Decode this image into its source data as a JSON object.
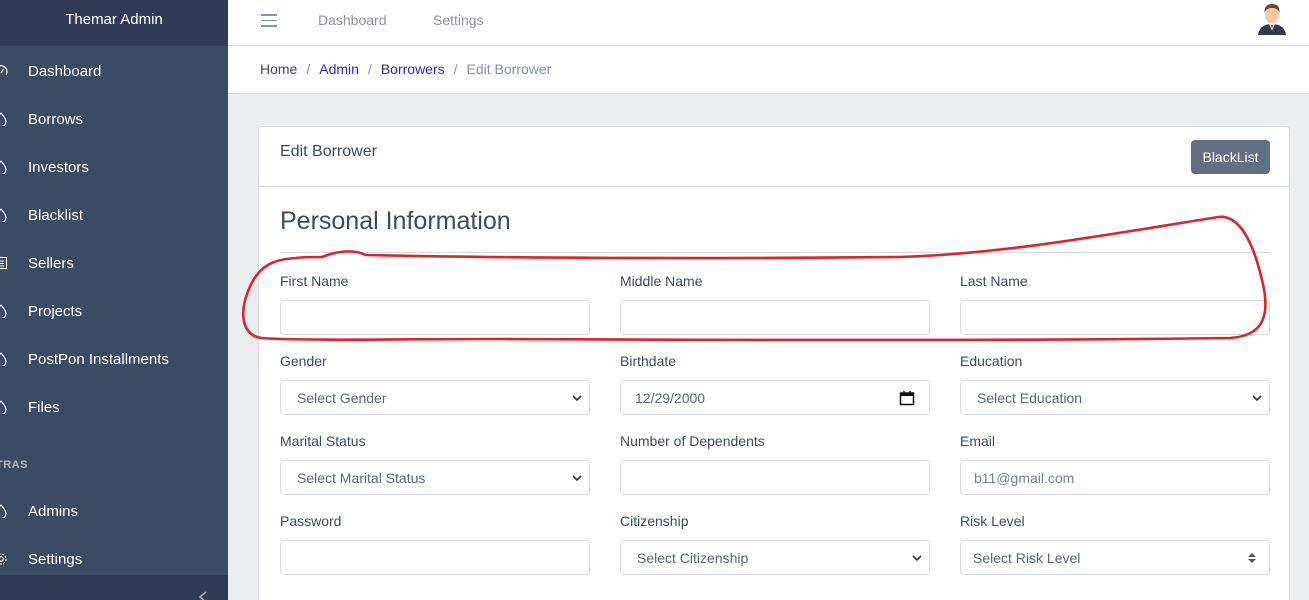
{
  "sidebar": {
    "brand": "Themar Admin",
    "items": [
      {
        "label": "Dashboard",
        "icon": "speedometer-icon"
      },
      {
        "label": "Borrows",
        "icon": "drop-icon"
      },
      {
        "label": "Investors",
        "icon": "drop-icon"
      },
      {
        "label": "Blacklist",
        "icon": "drop-icon"
      },
      {
        "label": "Sellers",
        "icon": "list-icon"
      },
      {
        "label": "Projects",
        "icon": "drop-icon"
      },
      {
        "label": "PostPon Installments",
        "icon": "drop-icon"
      },
      {
        "label": "Files",
        "icon": "drop-icon"
      }
    ],
    "section_title": "TRAS",
    "extra_items": [
      {
        "label": "Admins",
        "icon": "drop-icon"
      },
      {
        "label": "Settings",
        "icon": "gear-icon"
      }
    ]
  },
  "header": {
    "links": [
      "Dashboard",
      "Settings"
    ]
  },
  "breadcrumb": {
    "items": [
      "Home",
      "Admin",
      "Borrowers",
      "Edit Borrower"
    ]
  },
  "card": {
    "title": "Edit Borrower",
    "blacklist_button": "BlackList",
    "section_title": "Personal Information"
  },
  "form": {
    "first_name": {
      "label": "First Name",
      "value": ""
    },
    "middle_name": {
      "label": "Middle Name",
      "value": ""
    },
    "last_name": {
      "label": "Last Name",
      "value": ""
    },
    "gender": {
      "label": "Gender",
      "value": "Select Gender"
    },
    "birthdate": {
      "label": "Birthdate",
      "value": "12/29/2000"
    },
    "education": {
      "label": "Education",
      "value": "Select Education"
    },
    "marital_status": {
      "label": "Marital Status",
      "value": "Select Marital Status"
    },
    "dependents": {
      "label": "Number of Dependents",
      "value": ""
    },
    "email": {
      "label": "Email",
      "value": "b11@gmail.com"
    },
    "password": {
      "label": "Password",
      "value": ""
    },
    "citizenship": {
      "label": "Citizenship",
      "value": "Select Citizenship"
    },
    "risk_level": {
      "label": "Risk Level",
      "value": "Select Risk Level"
    }
  },
  "colors": {
    "sidebar": "#3c4b64",
    "brand_bar": "#303c54",
    "link": "#321fdb",
    "button": "#636f83",
    "annotation": "#d9262b"
  }
}
